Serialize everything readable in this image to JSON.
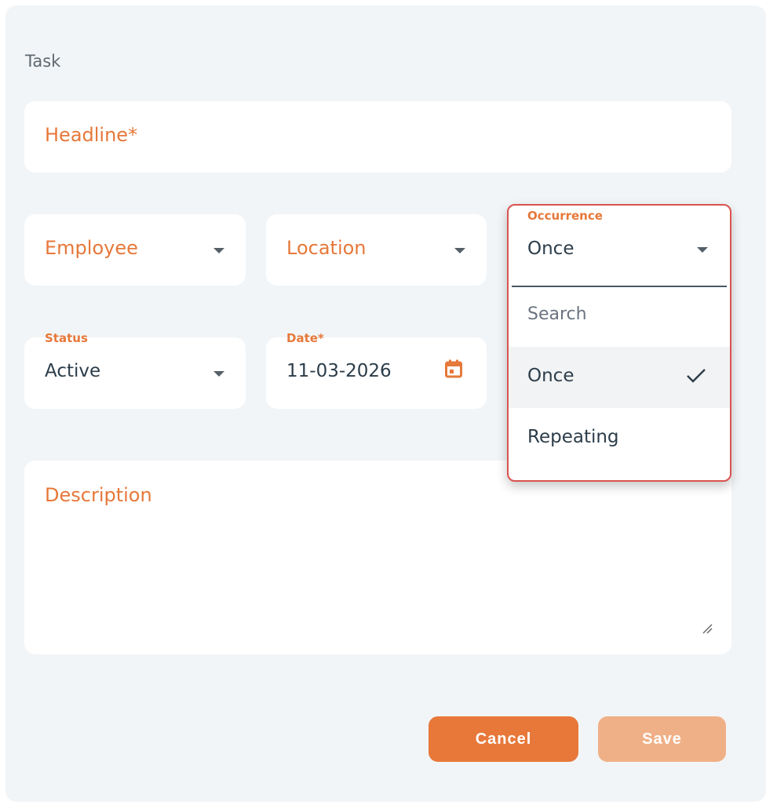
{
  "form": {
    "title": "Task",
    "headline_placeholder": "Headline*",
    "employee_placeholder": "Employee",
    "location_placeholder": "Location",
    "status": {
      "label": "Status",
      "value": "Active"
    },
    "date": {
      "label": "Date*",
      "value": "11-03-2026"
    },
    "description_placeholder": "Description"
  },
  "occurrence": {
    "label": "Occurrence",
    "value": "Once",
    "search_placeholder": "Search",
    "options": [
      {
        "label": "Once",
        "selected": true
      },
      {
        "label": "Repeating",
        "selected": false
      }
    ]
  },
  "actions": {
    "cancel_label": "Cancel",
    "save_label": "Save"
  },
  "colors": {
    "accent": "#e6783a",
    "highlight_border": "#d9534f",
    "panel_background": "#f2f5f7"
  }
}
